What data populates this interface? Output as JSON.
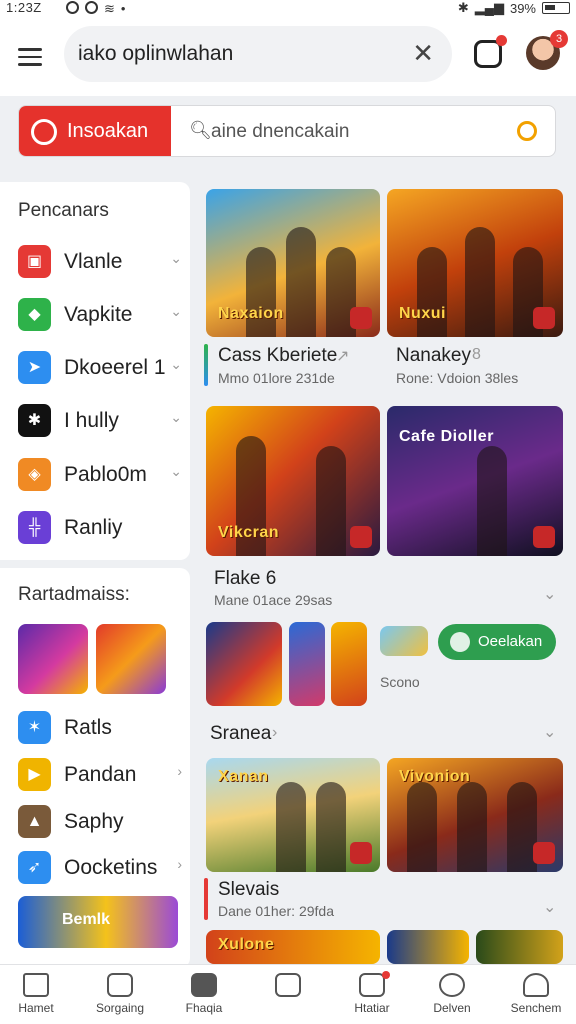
{
  "status_bar": {
    "time": "1:23Z",
    "battery": "39%"
  },
  "top_bar": {
    "search_text": "iako oplinwlahan"
  },
  "avatar": {
    "badge_count": "3"
  },
  "search_row": {
    "brand_label": "Insoakan",
    "placeholder": "aine dnencakain"
  },
  "sidebar": {
    "section1_title": "Pencanars",
    "categories": [
      {
        "label": "Vlanle",
        "color": "#e53935",
        "glyph": "▣"
      },
      {
        "label": "Vapkite",
        "color": "#2eb24a",
        "glyph": "◆"
      },
      {
        "label": "Dkoeerel 1",
        "color": "#2d8ef0",
        "glyph": "➤"
      },
      {
        "label": "I hully",
        "color": "#111111",
        "glyph": "✱"
      },
      {
        "label": "Pablo0m",
        "color": "#f08a24",
        "glyph": "◈"
      },
      {
        "label": "Ranliy",
        "color": "#6a3fd6",
        "glyph": "╬"
      }
    ],
    "section2_title": "Rartadmaiss:",
    "apps": [
      {
        "label": "Ratls",
        "color": "#2d8ef0",
        "glyph": "✶"
      },
      {
        "label": "Pandan",
        "color": "#f0b400",
        "glyph": "▶"
      },
      {
        "label": "Saphy",
        "color": "#7a5a3a",
        "glyph": "▲"
      },
      {
        "label": "Oocketins",
        "color": "#2d8ef0",
        "glyph": "➶"
      }
    ],
    "banner_text": "Bemlk"
  },
  "main": {
    "row1": [
      {
        "title": "Cass Kberiete",
        "sub": "Mmo 01lore 231de",
        "art": "Naxaion",
        "mark": "↗"
      },
      {
        "title": "Nanakey",
        "sub": "Rone: Vdoion 38les",
        "art": "Nuxui",
        "mark": "8"
      }
    ],
    "row2": [
      {
        "art": "Vikcran"
      },
      {
        "art": "Cafe Dioller"
      }
    ],
    "section_title": "Flake 6",
    "section_sub": "Mane 01ace 29sas",
    "action_label": "Oeelakan",
    "strip_sub": "Scono",
    "section2_title": "Sranea",
    "row3": [
      {
        "art": "Xanan"
      },
      {
        "art": "Vivonion"
      }
    ],
    "section3_title": "Slevais",
    "section3_sub": "Dane 01her: 29fda",
    "row4": [
      {
        "art": "Xulone"
      }
    ]
  },
  "bottom_nav": [
    {
      "label": "Hamet"
    },
    {
      "label": "Sorgaing"
    },
    {
      "label": "Fhaqia"
    },
    {
      "label": ""
    },
    {
      "label": "Htatiar"
    },
    {
      "label": "Delven"
    },
    {
      "label": "Senchem"
    }
  ]
}
